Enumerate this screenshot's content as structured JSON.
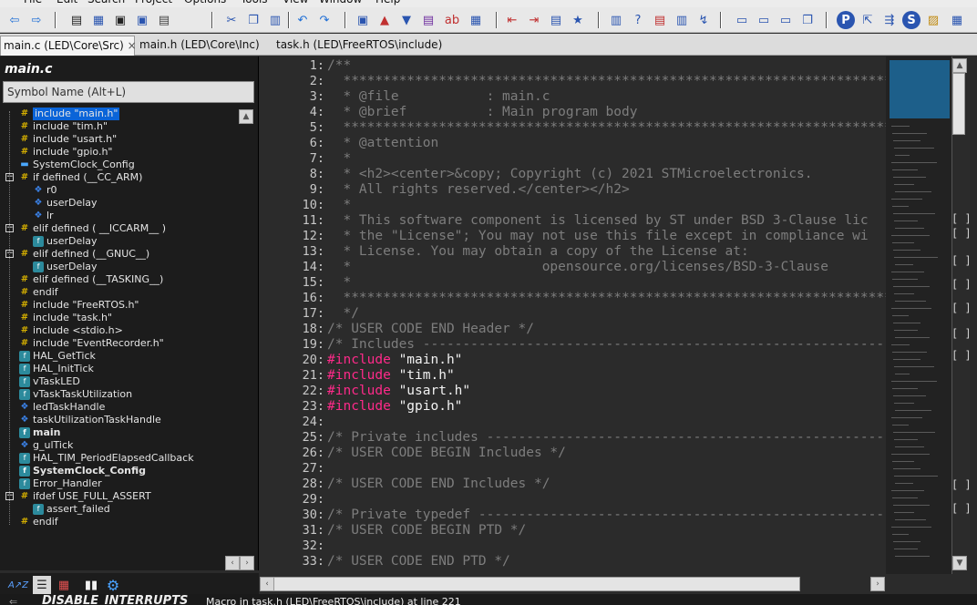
{
  "menu": [
    "File",
    "Edit",
    "Search",
    "Project",
    "Options",
    "Tools",
    "View",
    "Window",
    "Help"
  ],
  "tabs": [
    {
      "label": "main.c (LED\\Core\\Src)",
      "close": "×",
      "active": true
    },
    {
      "label": "main.h (LED\\Core\\Inc)",
      "active": false
    },
    {
      "label": "task.h (LED\\FreeRTOS\\include)",
      "active": false
    }
  ],
  "symbol_panel": {
    "title": "main.c",
    "search_placeholder": "Symbol Name (Alt+L)",
    "items": [
      {
        "label": "include \"main.h\"",
        "icon": "hash-icon",
        "selected": true
      },
      {
        "label": "include \"tim.h\"",
        "icon": "hash-icon"
      },
      {
        "label": "include \"usart.h\"",
        "icon": "hash-icon"
      },
      {
        "label": "include \"gpio.h\"",
        "icon": "hash-icon"
      },
      {
        "label": "SystemClock_Config",
        "icon": "prototype-icon"
      },
      {
        "label": "if defined (__CC_ARM)",
        "icon": "hash-icon"
      },
      {
        "label": "r0",
        "icon": "variable-icon"
      },
      {
        "label": "userDelay",
        "icon": "variable-icon"
      },
      {
        "label": "lr",
        "icon": "variable-icon"
      },
      {
        "label": "elif defined ( __ICCARM__ )",
        "icon": "hash-icon"
      },
      {
        "label": "userDelay",
        "icon": "function-icon"
      },
      {
        "label": "elif defined (__GNUC__)",
        "icon": "hash-icon"
      },
      {
        "label": "userDelay",
        "icon": "function-icon"
      },
      {
        "label": "elif defined (__TASKING__)",
        "icon": "hash-icon"
      },
      {
        "label": "endif",
        "icon": "hash-icon"
      },
      {
        "label": "include \"FreeRTOS.h\"",
        "icon": "hash-icon"
      },
      {
        "label": "include \"task.h\"",
        "icon": "hash-icon"
      },
      {
        "label": "include <stdio.h>",
        "icon": "hash-icon"
      },
      {
        "label": "include \"EventRecorder.h\"",
        "icon": "hash-icon"
      },
      {
        "label": "HAL_GetTick",
        "icon": "function-icon"
      },
      {
        "label": "HAL_InitTick",
        "icon": "function-icon"
      },
      {
        "label": "vTaskLED",
        "icon": "function-icon"
      },
      {
        "label": "vTaskTaskUtilization",
        "icon": "function-icon"
      },
      {
        "label": "ledTaskHandle",
        "icon": "variable-icon"
      },
      {
        "label": "taskUtilizationTaskHandle",
        "icon": "variable-icon"
      },
      {
        "label": "main",
        "icon": "function-icon",
        "bold": true
      },
      {
        "label": "g_ulTick",
        "icon": "variable-icon"
      },
      {
        "label": "HAL_TIM_PeriodElapsedCallback",
        "icon": "function-icon"
      },
      {
        "label": "SystemClock_Config",
        "icon": "function-icon",
        "bold": true
      },
      {
        "label": "Error_Handler",
        "icon": "function-icon"
      },
      {
        "label": "ifdef USE_FULL_ASSERT",
        "icon": "hash-icon"
      },
      {
        "label": "assert_failed",
        "icon": "function-icon"
      },
      {
        "label": "endif",
        "icon": "hash-icon"
      }
    ]
  },
  "editor": {
    "lines": [
      {
        "n": "1:",
        "t": "/**"
      },
      {
        "n": "2:",
        "t": "  ******************************************************************************"
      },
      {
        "n": "3:",
        "t": "  * @file           : main.c"
      },
      {
        "n": "4:",
        "t": "  * @brief          : Main program body"
      },
      {
        "n": "5:",
        "t": "  ******************************************************************************"
      },
      {
        "n": "6:",
        "t": "  * @attention"
      },
      {
        "n": "7:",
        "t": "  *"
      },
      {
        "n": "8:",
        "t": "  * <h2><center>&copy; Copyright (c) 2021 STMicroelectronics."
      },
      {
        "n": "9:",
        "t": "  * All rights reserved.</center></h2>"
      },
      {
        "n": "10:",
        "t": "  *"
      },
      {
        "n": "11:",
        "t": "  * This software component is licensed by ST under BSD 3-Clause lic"
      },
      {
        "n": "12:",
        "t": "  * the \"License\"; You may not use this file except in compliance wi"
      },
      {
        "n": "13:",
        "t": "  * License. You may obtain a copy of the License at:"
      },
      {
        "n": "14:",
        "t": "  *                        opensource.org/licenses/BSD-3-Clause"
      },
      {
        "n": "15:",
        "t": "  *"
      },
      {
        "n": "16:",
        "t": "  ******************************************************************************"
      },
      {
        "n": "17:",
        "t": "  */"
      },
      {
        "n": "18:",
        "t": "/* USER CODE END Header */"
      },
      {
        "n": "19:",
        "t": "/* Includes ------------------------------------------------------------------*/"
      },
      {
        "n": "20:",
        "kw": "#include",
        "str": " \"main.h\""
      },
      {
        "n": "21:",
        "kw": "#include",
        "str": " \"tim.h\""
      },
      {
        "n": "22:",
        "kw": "#include",
        "str": " \"usart.h\""
      },
      {
        "n": "23:",
        "kw": "#include",
        "str": " \"gpio.h\""
      },
      {
        "n": "24:",
        "t": ""
      },
      {
        "n": "25:",
        "t": "/* Private includes ----------------------------------------------------------*/"
      },
      {
        "n": "26:",
        "t": "/* USER CODE BEGIN Includes */"
      },
      {
        "n": "27:",
        "t": ""
      },
      {
        "n": "28:",
        "t": "/* USER CODE END Includes */"
      },
      {
        "n": "29:",
        "t": ""
      },
      {
        "n": "30:",
        "t": "/* Private typedef -----------------------------------------------------------*/"
      },
      {
        "n": "31:",
        "t": "/* USER CODE BEGIN PTD */"
      },
      {
        "n": "32:",
        "t": ""
      },
      {
        "n": "33:",
        "t": "/* USER CODE END PTD */"
      }
    ]
  },
  "status": {
    "text": "DISABLE_INTERRUPTS",
    "path": "Macro in task.h (LED\\FreeRTOS\\include) at line 221"
  }
}
